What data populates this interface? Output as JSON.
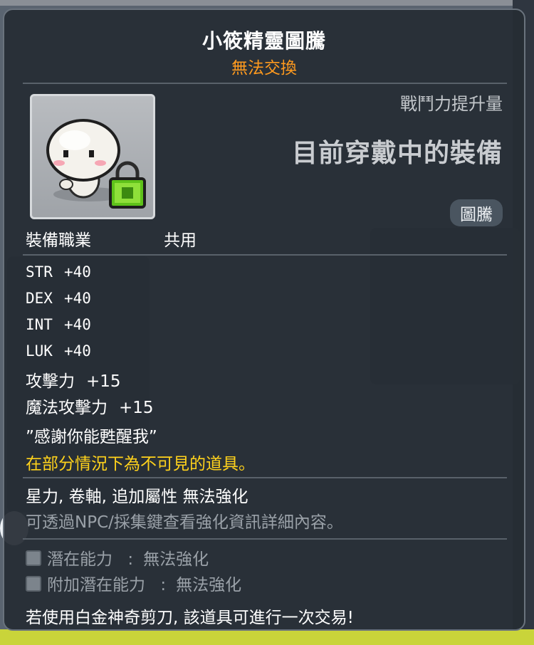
{
  "item": {
    "name": "小筱精靈圖騰",
    "trade_status": "無法交換",
    "power_label": "戰鬥力提升量",
    "equipped_label": "目前穿戴中的裝備",
    "category": "圖騰",
    "job_label": "裝備職業",
    "job_value": "共用"
  },
  "stats": [
    {
      "name": "STR",
      "value": "+40"
    },
    {
      "name": "DEX",
      "value": "+40"
    },
    {
      "name": "INT",
      "value": "+40"
    },
    {
      "name": "LUK",
      "value": "+40"
    },
    {
      "name": "攻擊力",
      "value": "+15"
    },
    {
      "name": "魔法攻擊力",
      "value": "+15"
    }
  ],
  "description": {
    "quote": "”感謝你能甦醒我”",
    "invisible_note": "在部分情況下為不可見的道具。",
    "no_enhance": "星力, 卷軸, 追加屬性 無法強化",
    "npc_hint": "可透過NPC/採集鍵查看強化資訊詳細內容。"
  },
  "potentials": [
    {
      "label": "潛在能力",
      "sep": ":",
      "status": "無法強化"
    },
    {
      "label": "附加潛在能力",
      "sep": ":",
      "status": "無法強化"
    }
  ],
  "trade_hint": "若使用白金神奇剪刀, 該道具可進行一次交易!",
  "colors": {
    "title": "#ffffff",
    "untradeable": "#ff9a1e",
    "notice": "#ffd21c",
    "disabled": "#9aa1a8",
    "lock": "#5ec21a"
  }
}
